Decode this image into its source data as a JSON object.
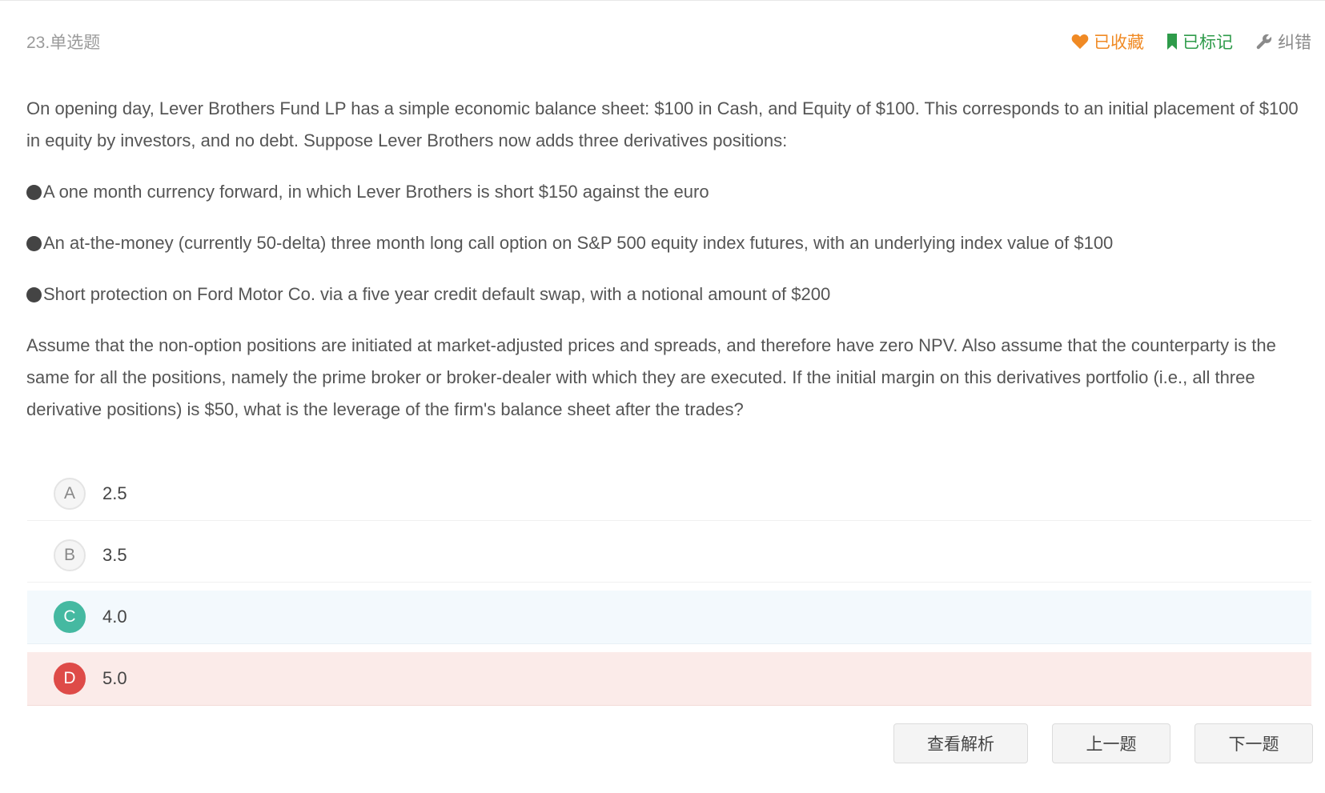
{
  "question": {
    "type_label": "23.单选题",
    "paragraphs": [
      "On opening day, Lever Brothers Fund LP has a simple economic balance sheet: $100 in Cash, and Equity of $100. This corresponds to an initial placement of $100 in equity by investors, and no debt. Suppose Lever Brothers now adds three derivatives positions:"
    ],
    "bullets": [
      "A one month currency forward, in which Lever Brothers is short $150 against the euro",
      "An at-the-money (currently 50-delta) three month long call option on S&P 500 equity index futures, with an underlying index value of $100",
      "Short protection on Ford Motor Co. via a five year credit default swap, with a notional amount of $200"
    ],
    "closing": "Assume that the non-option positions are initiated at market-adjusted prices and spreads, and therefore have zero NPV. Also assume that the counterparty is the same for all the positions, namely the prime broker or broker-dealer with which they are executed. If the initial margin on this derivatives portfolio (i.e., all three derivative positions) is $50, what is the leverage of the firm's balance sheet after the trades?"
  },
  "actions": {
    "favorite": {
      "label": "已收藏",
      "icon": "heart-icon",
      "color": "#f08a24"
    },
    "marked": {
      "label": "已标记",
      "icon": "bookmark-icon",
      "color": "#2e9b4a"
    },
    "report": {
      "label": "纠错",
      "icon": "wrench-icon",
      "color": "#8a8a8a"
    }
  },
  "options": [
    {
      "letter": "A",
      "text": "2.5",
      "state": "normal"
    },
    {
      "letter": "B",
      "text": "3.5",
      "state": "normal"
    },
    {
      "letter": "C",
      "text": "4.0",
      "state": "correct"
    },
    {
      "letter": "D",
      "text": "5.0",
      "state": "wrong"
    }
  ],
  "footer": {
    "analysis_label": "查看解析",
    "prev_label": "上一题",
    "next_label": "下一题"
  },
  "colors": {
    "correct": "#45b9a1",
    "wrong": "#de4b48",
    "correct_bg": "#f3f9fd",
    "wrong_bg": "#fbebe9"
  }
}
